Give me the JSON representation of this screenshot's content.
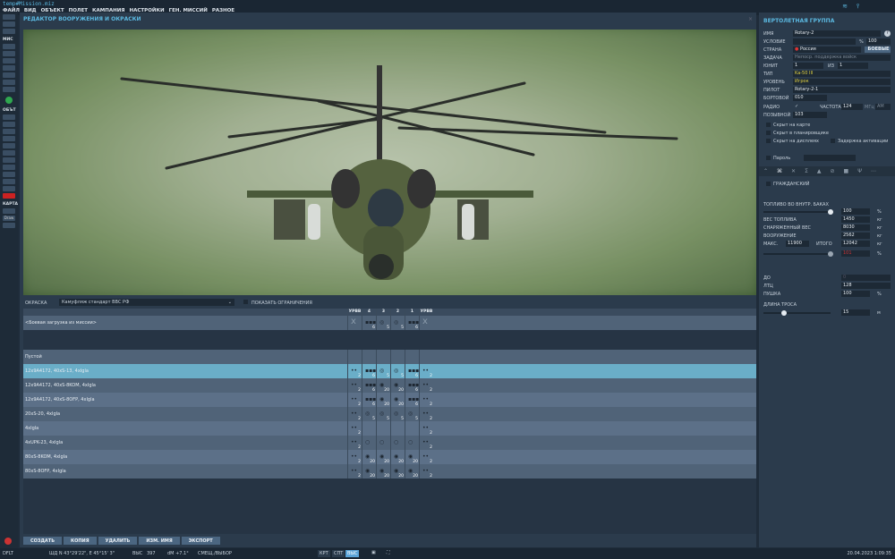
{
  "window": {
    "filename": "temp#Mission.miz"
  },
  "menu": [
    "ФАЙЛ",
    "ВИД",
    "ОБЪЕКТ",
    "ПОЛЕТ",
    "КАМПАНИЯ",
    "НАСТРОЙКИ",
    "ГЕН. МИССИЙ",
    "РАЗНОЕ"
  ],
  "sidebar": {
    "sections": [
      "МИС",
      "ОБЪТ",
      "КАРТА"
    ],
    "map_labels": [
      "Draw"
    ]
  },
  "editor": {
    "title": "РЕДАКТОР ВООРУЖЕНИЯ И ОКРАСКИ",
    "paint_label": "ОКРАСКА",
    "paint_value": "Камуфляж стандарт ВВС РФ",
    "show_limits": "ПОКАЗАТЬ ОГРАНИЧЕНИЯ"
  },
  "stations": {
    "headers": [
      "УРВВ",
      "4",
      "3",
      "2",
      "1",
      "УРВВ"
    ]
  },
  "loadouts": [
    {
      "name": "<Боевая загрузка из миссии>",
      "cells": [
        [
          "x",
          ""
        ],
        [
          "▪▪▪",
          "6"
        ],
        [
          "◎",
          "5"
        ],
        [
          "◎",
          "5"
        ],
        [
          "▪▪▪",
          "6"
        ],
        [
          "x",
          ""
        ]
      ]
    },
    {
      "name": "Пустой",
      "cells": []
    },
    {
      "name": "12x9A4172, 40xS-13, 4xIgla",
      "selected": true,
      "cells": [
        [
          "••",
          "2"
        ],
        [
          "▪▪▪",
          "6"
        ],
        [
          "◎",
          "5"
        ],
        [
          "◎",
          "5"
        ],
        [
          "▪▪▪",
          "6"
        ],
        [
          "••",
          "2"
        ]
      ]
    },
    {
      "name": "12x9A4172, 40xS-8KOM, 4xIgla",
      "cells": [
        [
          "••",
          "2"
        ],
        [
          "▪▪▪",
          "6"
        ],
        [
          "◉",
          "20"
        ],
        [
          "◉",
          "20"
        ],
        [
          "▪▪▪",
          "6"
        ],
        [
          "••",
          "2"
        ]
      ]
    },
    {
      "name": "12x9A4172, 40xS-8OFP, 4xIgla",
      "cells": [
        [
          "••",
          "2"
        ],
        [
          "▪▪▪",
          "6"
        ],
        [
          "◉",
          "20"
        ],
        [
          "◉",
          "20"
        ],
        [
          "▪▪▪",
          "6"
        ],
        [
          "••",
          "2"
        ]
      ]
    },
    {
      "name": "20xS-20, 4xIgla",
      "cells": [
        [
          "••",
          "2"
        ],
        [
          "◎",
          "5"
        ],
        [
          "◎",
          "5"
        ],
        [
          "◎",
          "5"
        ],
        [
          "◎",
          "5"
        ],
        [
          "••",
          "2"
        ]
      ]
    },
    {
      "name": "4xIgla",
      "cells": [
        [
          "••",
          "2"
        ],
        [
          "",
          ""
        ],
        [
          "",
          ""
        ],
        [
          "",
          ""
        ],
        [
          "",
          ""
        ],
        [
          "••",
          "2"
        ]
      ]
    },
    {
      "name": "4xUPK-23, 4xIgla",
      "cells": [
        [
          "••",
          "2"
        ],
        [
          "○",
          ""
        ],
        [
          "○",
          ""
        ],
        [
          "○",
          ""
        ],
        [
          "○",
          ""
        ],
        [
          "••",
          "2"
        ]
      ]
    },
    {
      "name": "80xS-8KOM, 4xIgla",
      "cells": [
        [
          "••",
          "2"
        ],
        [
          "◉",
          "20"
        ],
        [
          "◉",
          "20"
        ],
        [
          "◉",
          "20"
        ],
        [
          "◉",
          "20"
        ],
        [
          "••",
          "2"
        ]
      ]
    },
    {
      "name": "80xS-8OFP, 4xIgla",
      "cells": [
        [
          "••",
          "2"
        ],
        [
          "◉",
          "20"
        ],
        [
          "◉",
          "20"
        ],
        [
          "◉",
          "20"
        ],
        [
          "◉",
          "20"
        ],
        [
          "••",
          "2"
        ]
      ]
    }
  ],
  "buttons": [
    "СОЗДАТЬ",
    "КОПИЯ",
    "УДАЛИТЬ",
    "ИЗМ. ИМЯ",
    "ЭКСПОРТ"
  ],
  "group": {
    "title": "ВЕРТОЛЕТНАЯ ГРУППА",
    "name_label": "ИМЯ",
    "name": "Rotary-2",
    "help": "?",
    "condition_label": "УСЛОВИЕ",
    "percent": "%",
    "condition_value": "100",
    "country_label": "СТРАНА",
    "country": "Россия",
    "combat_btn": "БОЕВЫЕ",
    "task_label": "ЗАДАЧА",
    "task": "Непоср. поддержка войск",
    "unit_label": "ЮНИТ",
    "unit": "1",
    "of": "ИЗ",
    "unit_total": "1",
    "type_label": "ТИП",
    "type": "Ka-50 III",
    "skill_label": "УРОВЕНЬ",
    "skill": "Игрок",
    "pilot_label": "ПИЛОТ",
    "pilot": "Rotary-2-1",
    "tail_label": "БОРТОВОЙ",
    "tail": "010",
    "radio_label": "РАДИО",
    "radio_check": "✓",
    "freq_label": "ЧАСТОТА",
    "freq": "124",
    "mhz": "МГц",
    "modulation": "AM",
    "callsign_label": "ПОЗЫВНОЙ",
    "callsign": "103",
    "hidden_map": "Скрыт на карте",
    "hidden_planner": "Скрыт в планировщике",
    "hidden_display": "Скрыт на дисплеях",
    "late_activation": "Задержка активации",
    "password": "Пароль",
    "civil": "ГРАЖДАНСКИЙ",
    "fuel_label": "ТОПЛИВО ВО ВНУТР. БАКАХ",
    "fuel_pct": "100",
    "fuel_fraction": 1.0,
    "fuel_weight_label": "ВЕС ТОПЛИВА",
    "fuel_weight": "1450",
    "empty_label": "СНАРЯЖЕННЫЙ ВЕС",
    "empty_weight": "8030",
    "weapons_label": "ВООРУЖЕНИЕ",
    "weapons_weight": "2562",
    "max_label": "МАКС.",
    "max": "11900",
    "total_label": "ИТОГО",
    "total": "12042",
    "load_pct": "101",
    "kg": "кг",
    "chaff_label": "ДО",
    "chaff": "0",
    "ltc_label": "ЛТЦ",
    "ltc": "128",
    "gun_label": "ПУШКА",
    "gun": "100",
    "rope_label": "ДЛИНА ТРОСА",
    "rope": "15",
    "rope_fraction": 0.28,
    "m": "м"
  },
  "status": {
    "layer": "DFLT",
    "coords": "ШД  N 43°29'22\", E 45°15' 3\"",
    "alt_label": "ВЫС",
    "alt": "397",
    "dm": "dM  +7.1°",
    "mode": "СМЕЩ./ВЫБОР",
    "views": [
      "КРТ",
      "СПТ",
      "ВЫС"
    ],
    "datetime": "20.04.2023 1:09:35"
  }
}
